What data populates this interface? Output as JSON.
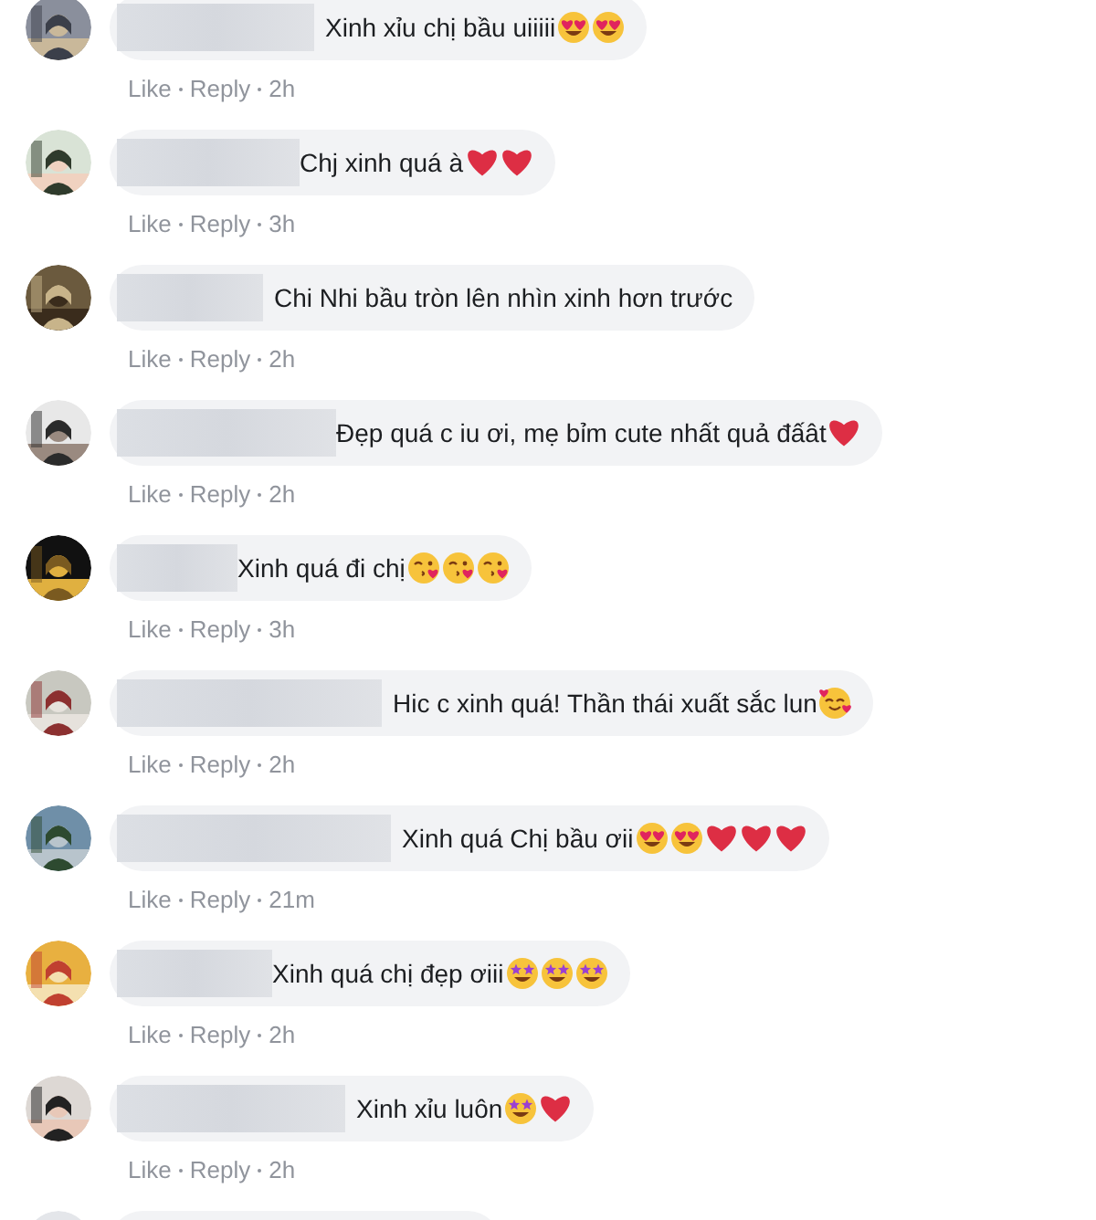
{
  "comments": [
    {
      "text": "Xinh xỉu chị bầu uiiiii",
      "emoji": [
        {
          "kind": "heart_eyes"
        },
        {
          "kind": "heart_eyes"
        }
      ],
      "actions": {
        "like": "Like",
        "reply": "Reply",
        "time": "2h"
      }
    },
    {
      "text": "Chj xinh quá à",
      "emoji": [
        {
          "kind": "heart"
        },
        {
          "kind": "heart"
        }
      ],
      "actions": {
        "like": "Like",
        "reply": "Reply",
        "time": "3h"
      }
    },
    {
      "text": "Chi Nhi bầu tròn lên nhìn xinh hơn trước",
      "actions": {
        "like": "Like",
        "reply": "Reply",
        "time": "2h"
      }
    },
    {
      "text": "Đẹp quá c iu ơi, mẹ bỉm cute nhất quả đấât",
      "emoji": [
        {
          "kind": "heart"
        }
      ],
      "actions": {
        "like": "Like",
        "reply": "Reply",
        "time": "2h"
      }
    },
    {
      "text": "Xinh quá đi chị",
      "emoji": [
        {
          "kind": "kiss"
        },
        {
          "kind": "kiss"
        },
        {
          "kind": "kiss"
        }
      ],
      "actions": {
        "like": "Like",
        "reply": "Reply",
        "time": "3h"
      }
    },
    {
      "text": "Hic c xinh quá! Thần thái xuất sắc lun",
      "emoji": [
        {
          "kind": "smiling_hearts"
        }
      ],
      "actions": {
        "like": "Like",
        "reply": "Reply",
        "time": "2h"
      }
    },
    {
      "text": "Xinh quá Chị bầu ơii",
      "emoji": [
        {
          "kind": "heart_eyes"
        },
        {
          "kind": "heart_eyes"
        },
        {
          "kind": "heart"
        },
        {
          "kind": "heart"
        },
        {
          "kind": "heart"
        }
      ],
      "actions": {
        "like": "Like",
        "reply": "Reply",
        "time": "21m"
      }
    },
    {
      "text": "Xinh quá chị đẹp ơiii",
      "emoji": [
        {
          "kind": "star_eyes"
        },
        {
          "kind": "star_eyes"
        },
        {
          "kind": "star_eyes"
        }
      ],
      "actions": {
        "like": "Like",
        "reply": "Reply",
        "time": "2h"
      }
    },
    {
      "text": "Xinh xỉu luôn",
      "emoji": [
        {
          "kind": "star_eyes"
        },
        {
          "kind": "heart"
        }
      ],
      "actions": {
        "like": "Like",
        "reply": "Reply",
        "time": "2h"
      }
    },
    {
      "kind": "cut_off"
    }
  ]
}
